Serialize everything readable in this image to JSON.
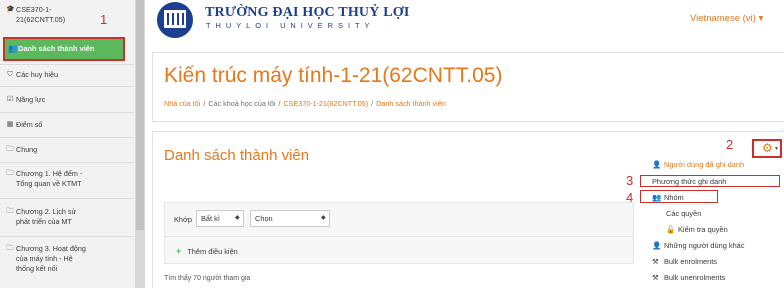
{
  "sidebar": {
    "course_short_line1": "CSE370-1-",
    "course_short_line2": "21(62CNTT.05)",
    "active_item": "Danh sách thành viên",
    "items": [
      {
        "label": "Các huy hiệu",
        "icon": "shield-icon"
      },
      {
        "label": "Năng lực",
        "icon": "checkbox-icon"
      },
      {
        "label": "Điểm số",
        "icon": "table-icon"
      },
      {
        "label": "Chung",
        "icon": "folder-icon"
      },
      {
        "label_line1": "Chương 1. Hệ đếm -",
        "label_line2": "Tổng quan về KTMT",
        "icon": "folder-icon"
      },
      {
        "label_line1": "Chương 2. Lịch sử",
        "label_line2": "phát triển của MT",
        "icon": "folder-icon"
      },
      {
        "label_line1": "Chương 3. Hoạt động",
        "label_line2": "của máy tính - Hệ",
        "label_line3": "thống kết nối",
        "icon": "folder-icon"
      }
    ]
  },
  "annotations": {
    "n1": "1",
    "n2": "2",
    "n3": "3",
    "n4": "4"
  },
  "header": {
    "logo_title": "TRƯỜNG ĐẠI HỌC THUỶ LỢI",
    "logo_sub": "THUYLOI UNIVERSITY",
    "language": "Vietnamese (vi) ▾"
  },
  "page": {
    "title": "Kiến trúc máy tính-1-21(62CNTT.05)",
    "breadcrumb": [
      "Nhà của tôi",
      "Các khoá học của tôi",
      "CSE370-1-21(62CNTT.05)",
      "Danh sách thành viên"
    ]
  },
  "participants": {
    "title": "Danh sách thành viên",
    "match_label": "Khớp",
    "match_value": "Bất kì",
    "filter_value": "Chọn",
    "add_condition": "Thêm điều kiện",
    "found_text": "Tìm thấy 70 người tham gia"
  },
  "dropdown": {
    "items": [
      {
        "label": "Người dùng đã ghi danh",
        "icon": "user-plus-icon"
      },
      {
        "label": "Phương thức ghi danh"
      },
      {
        "label": "Nhóm",
        "icon": "users-icon"
      },
      {
        "label": "Các quyền"
      },
      {
        "label": "Kiểm tra quyền",
        "icon": "unlock-icon"
      },
      {
        "label": "Những người dùng khác",
        "icon": "user-plus-icon"
      },
      {
        "label": "Bulk enrolments",
        "icon": "hammer-icon"
      },
      {
        "label": "Bulk unenrolments",
        "icon": "hammer-icon"
      }
    ]
  },
  "colors": {
    "accent": "#e8771a",
    "active": "#5cb85c",
    "highlight": "#c9302c",
    "brand": "#1d3f8f"
  }
}
